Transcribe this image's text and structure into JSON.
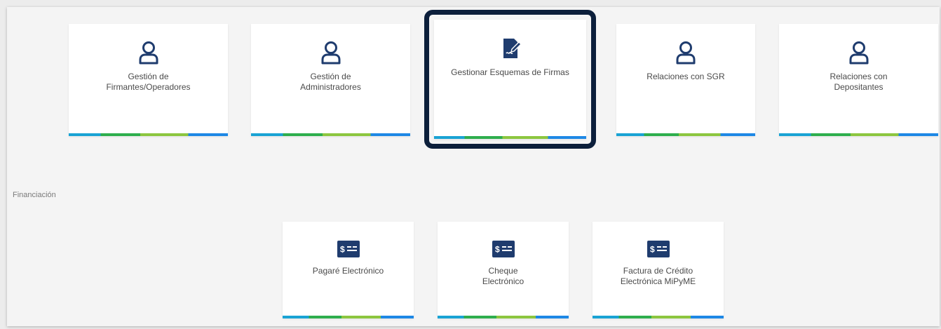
{
  "colors": {
    "icon": "#1f3c6e",
    "selected_border": "#0c1f3b",
    "stripe": [
      "#1aa3d4",
      "#2eae4d",
      "#8cc63f",
      "#1e88e5"
    ],
    "text": "#4a4a4a"
  },
  "top_cards": [
    {
      "label": "Gestión de Firmantes/Operadores",
      "icon": "user-icon"
    },
    {
      "label": "Gestión de Administradores",
      "icon": "user-icon"
    },
    {
      "label": "Gestionar Esquemas de Firmas",
      "icon": "sign-document-icon",
      "selected": true
    },
    {
      "label": "Relaciones con SGR",
      "icon": "user-icon"
    },
    {
      "label": "Relaciones con Depositantes",
      "icon": "user-icon"
    }
  ],
  "financing": {
    "title": "Financiación",
    "cards": [
      {
        "label": "Pagaré Electrónico",
        "icon": "money-card-icon"
      },
      {
        "label": "Cheque Electrónico",
        "icon": "money-card-icon"
      },
      {
        "label": "Factura de Crédito Electrónica MiPyME",
        "icon": "money-card-icon"
      }
    ]
  }
}
